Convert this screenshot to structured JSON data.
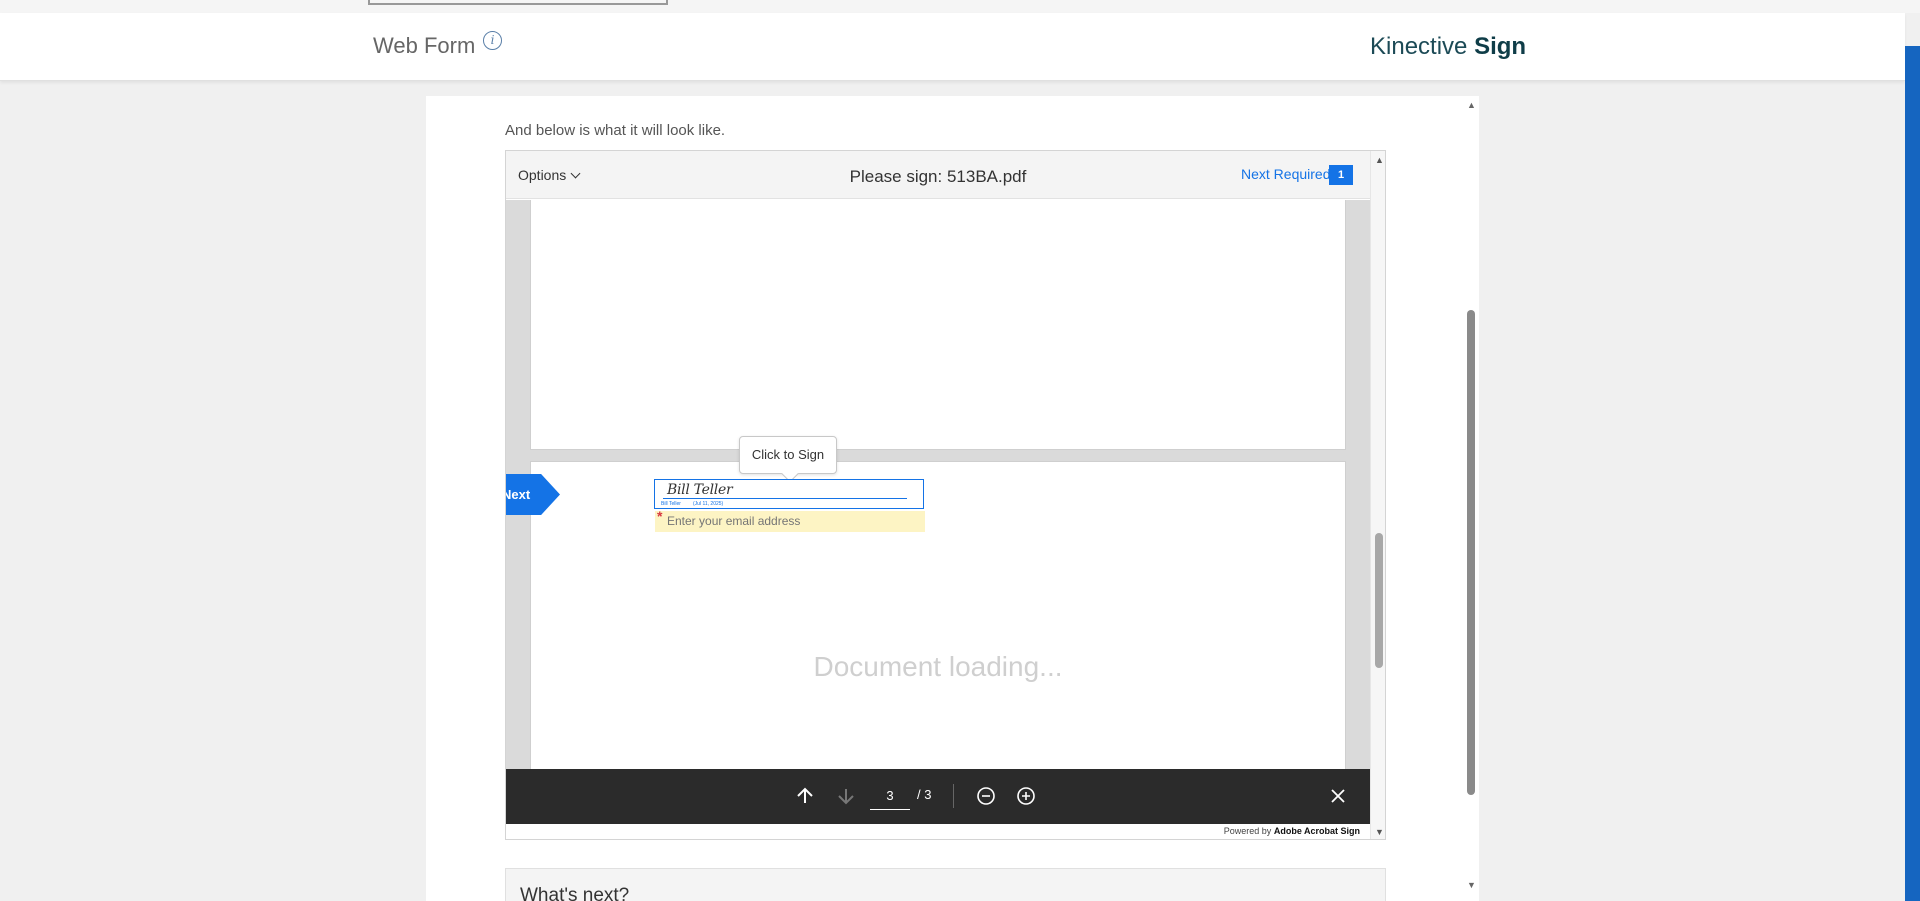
{
  "header": {
    "title": "Web Form",
    "info_icon": "info-icon",
    "brand_prefix": "Kinective",
    "brand_bold": "Sign"
  },
  "content": {
    "intro": "And below is what it will look like."
  },
  "signer": {
    "toolbar": {
      "options_label": "Options",
      "document_title": "Please sign: 513BA.pdf",
      "next_required_label": "Next Required",
      "next_required_count": "1"
    },
    "next_label": "Next",
    "tooltip": "Click to Sign",
    "signature": {
      "script": "Bill Teller",
      "caption_name": "Bill Teller",
      "caption_date": "(Jul 11, 2025)"
    },
    "email_placeholder": "Enter your email address",
    "loading": "Document loading...",
    "pager": {
      "current_page": "3",
      "total": "/ 3"
    },
    "powered_by_prefix": "Powered by",
    "powered_by_brand": "Adobe Acrobat Sign",
    "accent_color": "#1473e6"
  },
  "next_section": {
    "title": "What's next?"
  }
}
